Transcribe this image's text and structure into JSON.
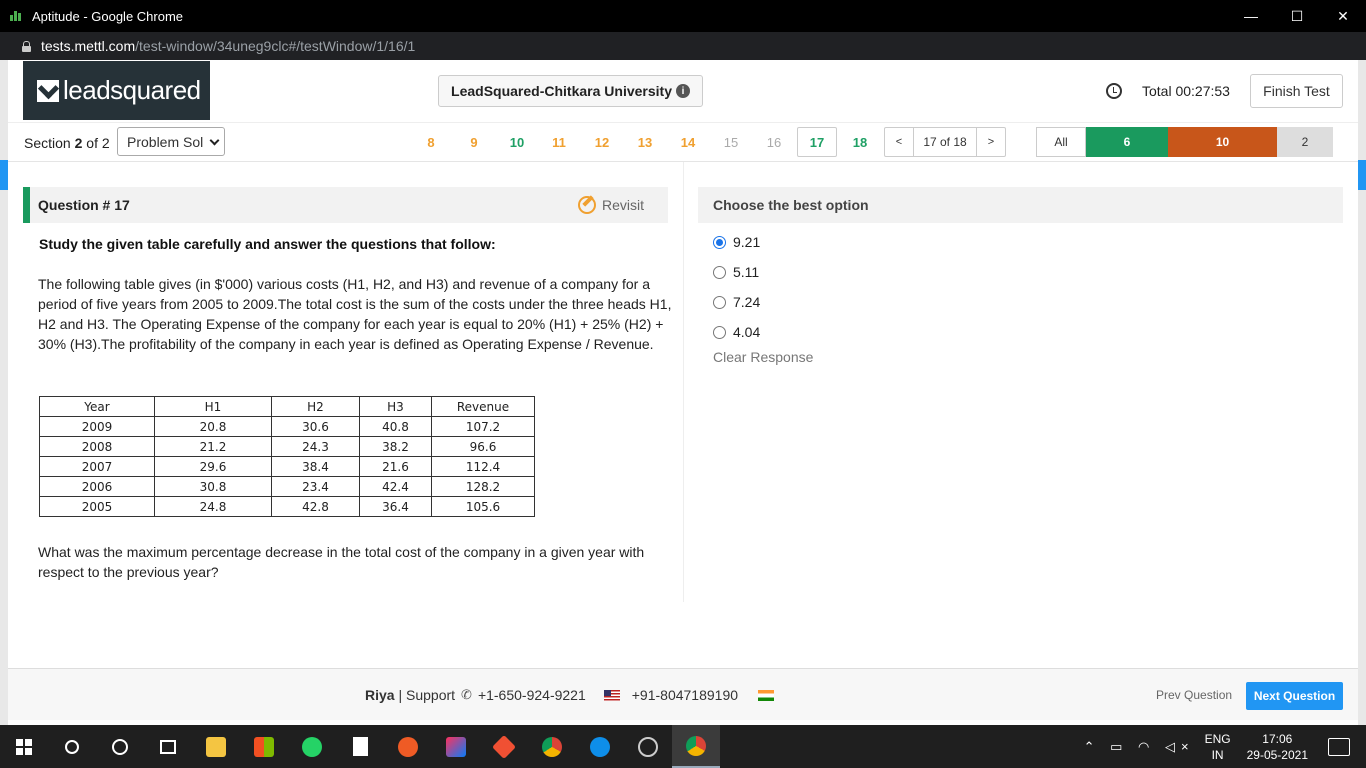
{
  "window": {
    "title": "Aptitude - Google Chrome",
    "minimize": "—",
    "maximize": "☐",
    "close": "✕"
  },
  "address": {
    "host": "tests.mettl.com",
    "path": "/test-window/34uneg9clc#/testWindow/1/16/1"
  },
  "header": {
    "logo_text": "leadsquared",
    "org": "LeadSquared-Chitkara University",
    "info_glyph": "i",
    "timer": "Total 00:27:53",
    "finish_label": "Finish Test"
  },
  "nav": {
    "section_word": "Section",
    "section_current": "2",
    "section_of": "of 2",
    "section_select": "Problem Sol",
    "questions": [
      {
        "num": "8",
        "state": "orange"
      },
      {
        "num": "9",
        "state": "orange"
      },
      {
        "num": "10",
        "state": "green"
      },
      {
        "num": "11",
        "state": "orange"
      },
      {
        "num": "12",
        "state": "orange"
      },
      {
        "num": "13",
        "state": "orange"
      },
      {
        "num": "14",
        "state": "orange"
      },
      {
        "num": "15",
        "state": "gray"
      },
      {
        "num": "16",
        "state": "gray"
      },
      {
        "num": "17",
        "state": "current"
      },
      {
        "num": "18",
        "state": "green"
      }
    ],
    "prev_arrow": "<",
    "page_info": "17 of 18",
    "next_arrow": ">",
    "filter_all": "All",
    "filter_answered": "6",
    "filter_not_answered": "10",
    "filter_review": "2"
  },
  "question": {
    "title": "Question # 17",
    "revisit": "Revisit",
    "instruction": "Study the given table carefully and answer the questions that follow:",
    "paragraph": "The following table gives (in $'000) various costs (H1, H2, and H3) and revenue of a company for a period of five years from 2005 to 2009.The total cost is the sum of the costs under the three heads H1, H2 and H3. The Operating Expense of the company for each year is equal to 20% (H1) + 25% (H2) + 30% (H3).The profitability of the company in each year is defined as Operating Expense / Revenue.",
    "table": {
      "headers": [
        "Year",
        "H1",
        "H2",
        "H3",
        "Revenue"
      ],
      "rows": [
        [
          "2009",
          "20.8",
          "30.6",
          "40.8",
          "107.2"
        ],
        [
          "2008",
          "21.2",
          "24.3",
          "38.2",
          "96.6"
        ],
        [
          "2007",
          "29.6",
          "38.4",
          "21.6",
          "112.4"
        ],
        [
          "2006",
          "30.8",
          "23.4",
          "42.4",
          "128.2"
        ],
        [
          "2005",
          "24.8",
          "42.8",
          "36.4",
          "105.6"
        ]
      ]
    },
    "prompt": "What was the maximum percentage decrease in the total cost of the company in a given year with respect to the previous year?"
  },
  "answer": {
    "heading": "Choose the best option",
    "options": [
      {
        "label": "9.21",
        "checked": true
      },
      {
        "label": "5.11",
        "checked": false
      },
      {
        "label": "7.24",
        "checked": false
      },
      {
        "label": "4.04",
        "checked": false
      }
    ],
    "clear": "Clear Response"
  },
  "footer": {
    "name": "Riya",
    "support": "| Support",
    "phone_us": "+1-650-924-9221",
    "phone_in": "+91-8047189190",
    "prev": "Prev Question",
    "next": "Next Question"
  },
  "taskbar": {
    "lang_top": "ENG",
    "lang_bottom": "IN",
    "time": "17:06",
    "date": "29-05-2021",
    "apps": [
      "start-icon",
      "search-icon",
      "cortana-icon",
      "task-view-icon",
      "file-explorer-icon",
      "store-icon",
      "whatsapp-icon",
      "notes-icon",
      "postman-icon",
      "intellij-icon",
      "git-icon",
      "chrome-icon",
      "teamviewer-icon",
      "obs-icon",
      "chrome-active-icon"
    ]
  }
}
